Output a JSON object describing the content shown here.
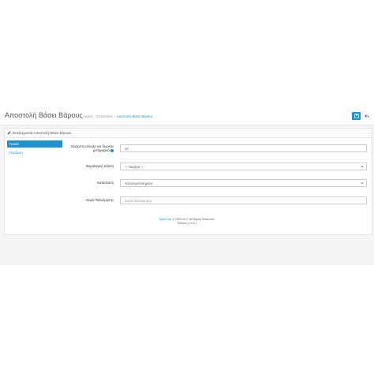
{
  "header": {
    "title": "Αποστολή Βάσει Βάρους",
    "breadcrumbs": [
      "Αρχική",
      "Επεκτάσεις",
      "Αποστολή Βάσει Βάρους"
    ]
  },
  "panel": {
    "heading": "Επεξεργασία Αποστολή Βάσει Βάρους"
  },
  "tabs": [
    {
      "label": "Γενικά"
    },
    {
      "label": "Γεωζώνη"
    }
  ],
  "form": {
    "rates": {
      "label_line1": "Ελάχιστο σύνολο για δωρεάν",
      "label_line2": "μεταφορικά",
      "value": "10"
    },
    "tax_class": {
      "label": "Φορολογική Κλάση",
      "value": " --- Κανένα --- "
    },
    "status": {
      "label": "Κατάσταση",
      "value": "Απενεργοποιημένο"
    },
    "sort_order": {
      "label": "Σειρά Ταξινόμησης",
      "placeholder": "Σειρά Ταξινόμησης"
    }
  },
  "footer": {
    "brand": "OpenCart",
    "copyright": " © 2009-2017 All Rights Reserved.",
    "version": "Έκδοση 2.0.3.1"
  },
  "colors": {
    "accent": "#1e91cf"
  }
}
